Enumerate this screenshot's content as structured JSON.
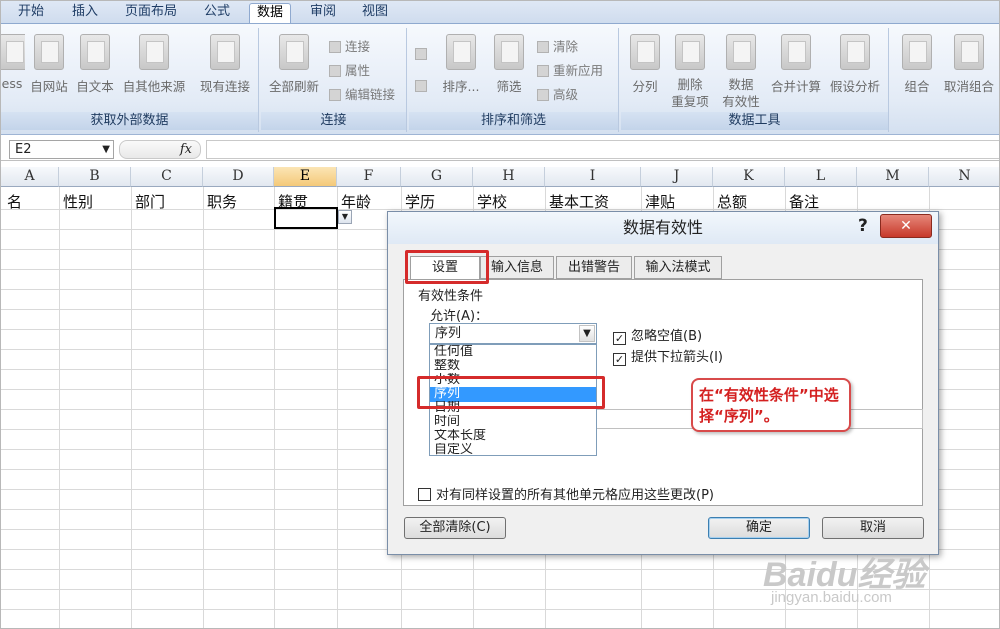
{
  "ribbon_tabs": [
    "开始",
    "插入",
    "页面布局",
    "公式",
    "数据",
    "审阅",
    "视图"
  ],
  "ribbon": {
    "external": {
      "label": "获取外部数据",
      "buttons": [
        "ess",
        "自网站",
        "自文本",
        "自其他来源"
      ],
      "existing": "现有连接"
    },
    "connections": {
      "label": "连接",
      "refresh": "全部刷新",
      "items": [
        "连接",
        "属性",
        "编辑链接"
      ]
    },
    "sort_filter": {
      "label": "排序和筛选",
      "sort": "排序...",
      "filter": "筛选",
      "items": [
        "清除",
        "重新应用",
        "高级"
      ]
    },
    "data_tools": {
      "label": "数据工具",
      "buttons": [
        "分列",
        "删除\n重复项",
        "数据\n有效性",
        "合并计算",
        "假设分析"
      ]
    },
    "outline": {
      "buttons": [
        "组合",
        "取消组合"
      ]
    }
  },
  "namebox": "E2",
  "fx": "fx",
  "columns": [
    "A",
    "B",
    "C",
    "D",
    "E",
    "F",
    "G",
    "H",
    "I",
    "J",
    "K",
    "L",
    "M",
    "N"
  ],
  "headers": [
    "名",
    "性别",
    "部门",
    "职务",
    "籍贯",
    "年龄",
    "学历",
    "学校",
    "基本工资",
    "津贴",
    "总额",
    "备注"
  ],
  "dialog": {
    "title": "数据有效性",
    "help": "?",
    "close": "✕",
    "tabs": [
      "设置",
      "输入信息",
      "出错警告",
      "输入法模式"
    ],
    "group_title": "有效性条件",
    "allow_label": "允许(A)：",
    "allow_value": "序列",
    "options": [
      "任何值",
      "整数",
      "小数",
      "序列",
      "日期",
      "时间",
      "文本长度",
      "自定义"
    ],
    "selected_option": "序列",
    "checks": [
      {
        "label": "忽略空值(B)",
        "checked": true
      },
      {
        "label": "提供下拉箭头(I)",
        "checked": true
      }
    ],
    "apply_all": "对有同样设置的所有其他单元格应用这些更改(P)",
    "clear_all": "全部清除(C)",
    "ok": "确定",
    "cancel": "取消"
  },
  "callout": "在“有效性条件”中选择“序列”。",
  "watermark": {
    "brand": "Baidu经验",
    "url": "jingyan.baidu.com"
  }
}
